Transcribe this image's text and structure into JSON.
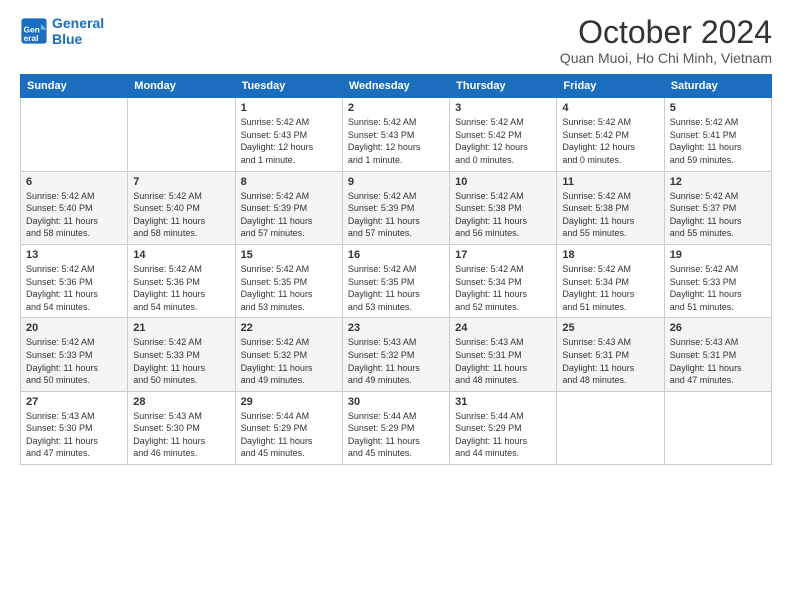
{
  "header": {
    "logo_line1": "General",
    "logo_line2": "Blue",
    "month": "October 2024",
    "location": "Quan Muoi, Ho Chi Minh, Vietnam"
  },
  "weekdays": [
    "Sunday",
    "Monday",
    "Tuesday",
    "Wednesday",
    "Thursday",
    "Friday",
    "Saturday"
  ],
  "weeks": [
    [
      {
        "day": "",
        "info": ""
      },
      {
        "day": "",
        "info": ""
      },
      {
        "day": "1",
        "info": "Sunrise: 5:42 AM\nSunset: 5:43 PM\nDaylight: 12 hours\nand 1 minute."
      },
      {
        "day": "2",
        "info": "Sunrise: 5:42 AM\nSunset: 5:43 PM\nDaylight: 12 hours\nand 1 minute."
      },
      {
        "day": "3",
        "info": "Sunrise: 5:42 AM\nSunset: 5:42 PM\nDaylight: 12 hours\nand 0 minutes."
      },
      {
        "day": "4",
        "info": "Sunrise: 5:42 AM\nSunset: 5:42 PM\nDaylight: 12 hours\nand 0 minutes."
      },
      {
        "day": "5",
        "info": "Sunrise: 5:42 AM\nSunset: 5:41 PM\nDaylight: 11 hours\nand 59 minutes."
      }
    ],
    [
      {
        "day": "6",
        "info": "Sunrise: 5:42 AM\nSunset: 5:40 PM\nDaylight: 11 hours\nand 58 minutes."
      },
      {
        "day": "7",
        "info": "Sunrise: 5:42 AM\nSunset: 5:40 PM\nDaylight: 11 hours\nand 58 minutes."
      },
      {
        "day": "8",
        "info": "Sunrise: 5:42 AM\nSunset: 5:39 PM\nDaylight: 11 hours\nand 57 minutes."
      },
      {
        "day": "9",
        "info": "Sunrise: 5:42 AM\nSunset: 5:39 PM\nDaylight: 11 hours\nand 57 minutes."
      },
      {
        "day": "10",
        "info": "Sunrise: 5:42 AM\nSunset: 5:38 PM\nDaylight: 11 hours\nand 56 minutes."
      },
      {
        "day": "11",
        "info": "Sunrise: 5:42 AM\nSunset: 5:38 PM\nDaylight: 11 hours\nand 55 minutes."
      },
      {
        "day": "12",
        "info": "Sunrise: 5:42 AM\nSunset: 5:37 PM\nDaylight: 11 hours\nand 55 minutes."
      }
    ],
    [
      {
        "day": "13",
        "info": "Sunrise: 5:42 AM\nSunset: 5:36 PM\nDaylight: 11 hours\nand 54 minutes."
      },
      {
        "day": "14",
        "info": "Sunrise: 5:42 AM\nSunset: 5:36 PM\nDaylight: 11 hours\nand 54 minutes."
      },
      {
        "day": "15",
        "info": "Sunrise: 5:42 AM\nSunset: 5:35 PM\nDaylight: 11 hours\nand 53 minutes."
      },
      {
        "day": "16",
        "info": "Sunrise: 5:42 AM\nSunset: 5:35 PM\nDaylight: 11 hours\nand 53 minutes."
      },
      {
        "day": "17",
        "info": "Sunrise: 5:42 AM\nSunset: 5:34 PM\nDaylight: 11 hours\nand 52 minutes."
      },
      {
        "day": "18",
        "info": "Sunrise: 5:42 AM\nSunset: 5:34 PM\nDaylight: 11 hours\nand 51 minutes."
      },
      {
        "day": "19",
        "info": "Sunrise: 5:42 AM\nSunset: 5:33 PM\nDaylight: 11 hours\nand 51 minutes."
      }
    ],
    [
      {
        "day": "20",
        "info": "Sunrise: 5:42 AM\nSunset: 5:33 PM\nDaylight: 11 hours\nand 50 minutes."
      },
      {
        "day": "21",
        "info": "Sunrise: 5:42 AM\nSunset: 5:33 PM\nDaylight: 11 hours\nand 50 minutes."
      },
      {
        "day": "22",
        "info": "Sunrise: 5:42 AM\nSunset: 5:32 PM\nDaylight: 11 hours\nand 49 minutes."
      },
      {
        "day": "23",
        "info": "Sunrise: 5:43 AM\nSunset: 5:32 PM\nDaylight: 11 hours\nand 49 minutes."
      },
      {
        "day": "24",
        "info": "Sunrise: 5:43 AM\nSunset: 5:31 PM\nDaylight: 11 hours\nand 48 minutes."
      },
      {
        "day": "25",
        "info": "Sunrise: 5:43 AM\nSunset: 5:31 PM\nDaylight: 11 hours\nand 48 minutes."
      },
      {
        "day": "26",
        "info": "Sunrise: 5:43 AM\nSunset: 5:31 PM\nDaylight: 11 hours\nand 47 minutes."
      }
    ],
    [
      {
        "day": "27",
        "info": "Sunrise: 5:43 AM\nSunset: 5:30 PM\nDaylight: 11 hours\nand 47 minutes."
      },
      {
        "day": "28",
        "info": "Sunrise: 5:43 AM\nSunset: 5:30 PM\nDaylight: 11 hours\nand 46 minutes."
      },
      {
        "day": "29",
        "info": "Sunrise: 5:44 AM\nSunset: 5:29 PM\nDaylight: 11 hours\nand 45 minutes."
      },
      {
        "day": "30",
        "info": "Sunrise: 5:44 AM\nSunset: 5:29 PM\nDaylight: 11 hours\nand 45 minutes."
      },
      {
        "day": "31",
        "info": "Sunrise: 5:44 AM\nSunset: 5:29 PM\nDaylight: 11 hours\nand 44 minutes."
      },
      {
        "day": "",
        "info": ""
      },
      {
        "day": "",
        "info": ""
      }
    ]
  ]
}
